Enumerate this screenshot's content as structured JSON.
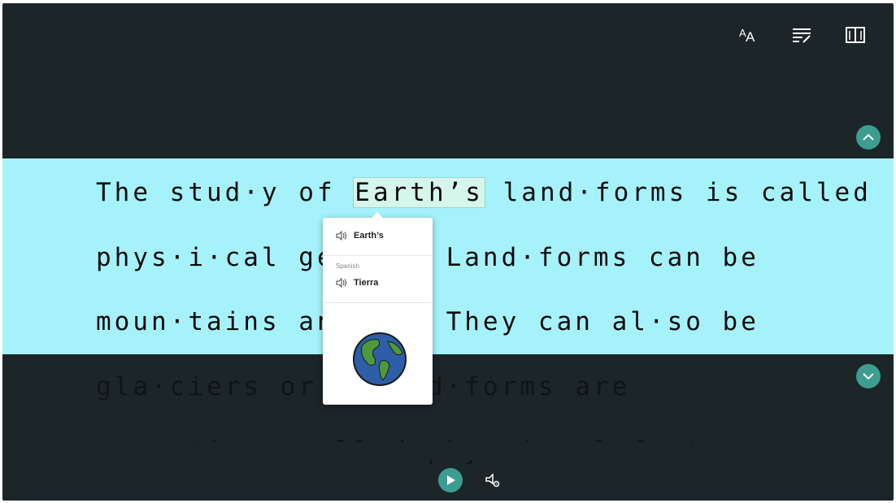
{
  "toolbar": {
    "icons": [
      "text-size-icon",
      "grammar-options-icon",
      "reading-preferences-icon"
    ],
    "text_size_label": "AA"
  },
  "reader": {
    "lines": [
      {
        "before": "The stud·y of ",
        "highlight": "Earth’s",
        "after": " land·forms is called"
      },
      {
        "text": "phys·i·cal ge·o        y. Land·forms can be"
      },
      {
        "text": "moun·tains and      ys. They can al·so be"
      },
      {
        "text": "gla·ciers or ri         and·forms are"
      },
      {
        "text": "some·times called phys·i·cal features."
      }
    ]
  },
  "dictionary_popup": {
    "word": "Earth’s",
    "language": "Spanish",
    "translation": "Tierra",
    "picture": "globe-image"
  },
  "colors": {
    "background": "#1c2528",
    "focus_band": "#a5f2fb",
    "accent": "#3c9d90",
    "highlight": "#d6f6ec"
  },
  "controls": {
    "play": "play-icon",
    "voice_settings": "voice-settings-icon"
  }
}
